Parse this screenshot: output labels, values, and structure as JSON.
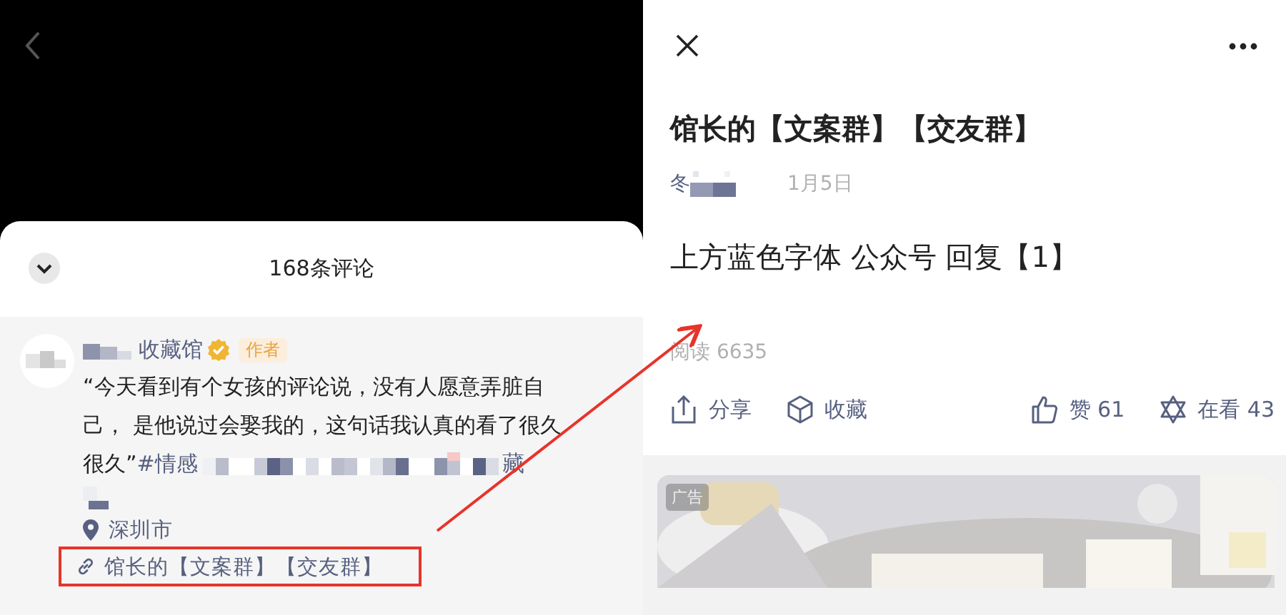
{
  "comments_panel": {
    "title": "168条评论",
    "comment": {
      "author": "收藏馆",
      "author_badge": "作者",
      "verified": true,
      "text": "“今天看到有个女孩的评论说，没有人愿意弄脏自己， 是他说过会娶我的，这句话我认真的看了很久",
      "text_end": "很久”",
      "hashtag": "#情感",
      "hashtag_tail": "藏",
      "location": "深圳市",
      "link": "馆长的【文案群】【交友群】"
    }
  },
  "article": {
    "title": "馆长的【文案群】【交友群】",
    "author": "冬",
    "date": "1月5日",
    "body": "上方蓝色字体 公众号 回复【1】",
    "reads": "阅读 6635",
    "actions": [
      {
        "kind": "share",
        "label": "分享"
      },
      {
        "kind": "collect",
        "label": "收藏"
      },
      {
        "kind": "like",
        "label": "赞 61"
      },
      {
        "kind": "watching",
        "label": "在看 43"
      }
    ],
    "ad": {
      "kind": "picture",
      "badge": "广告"
    }
  }
}
